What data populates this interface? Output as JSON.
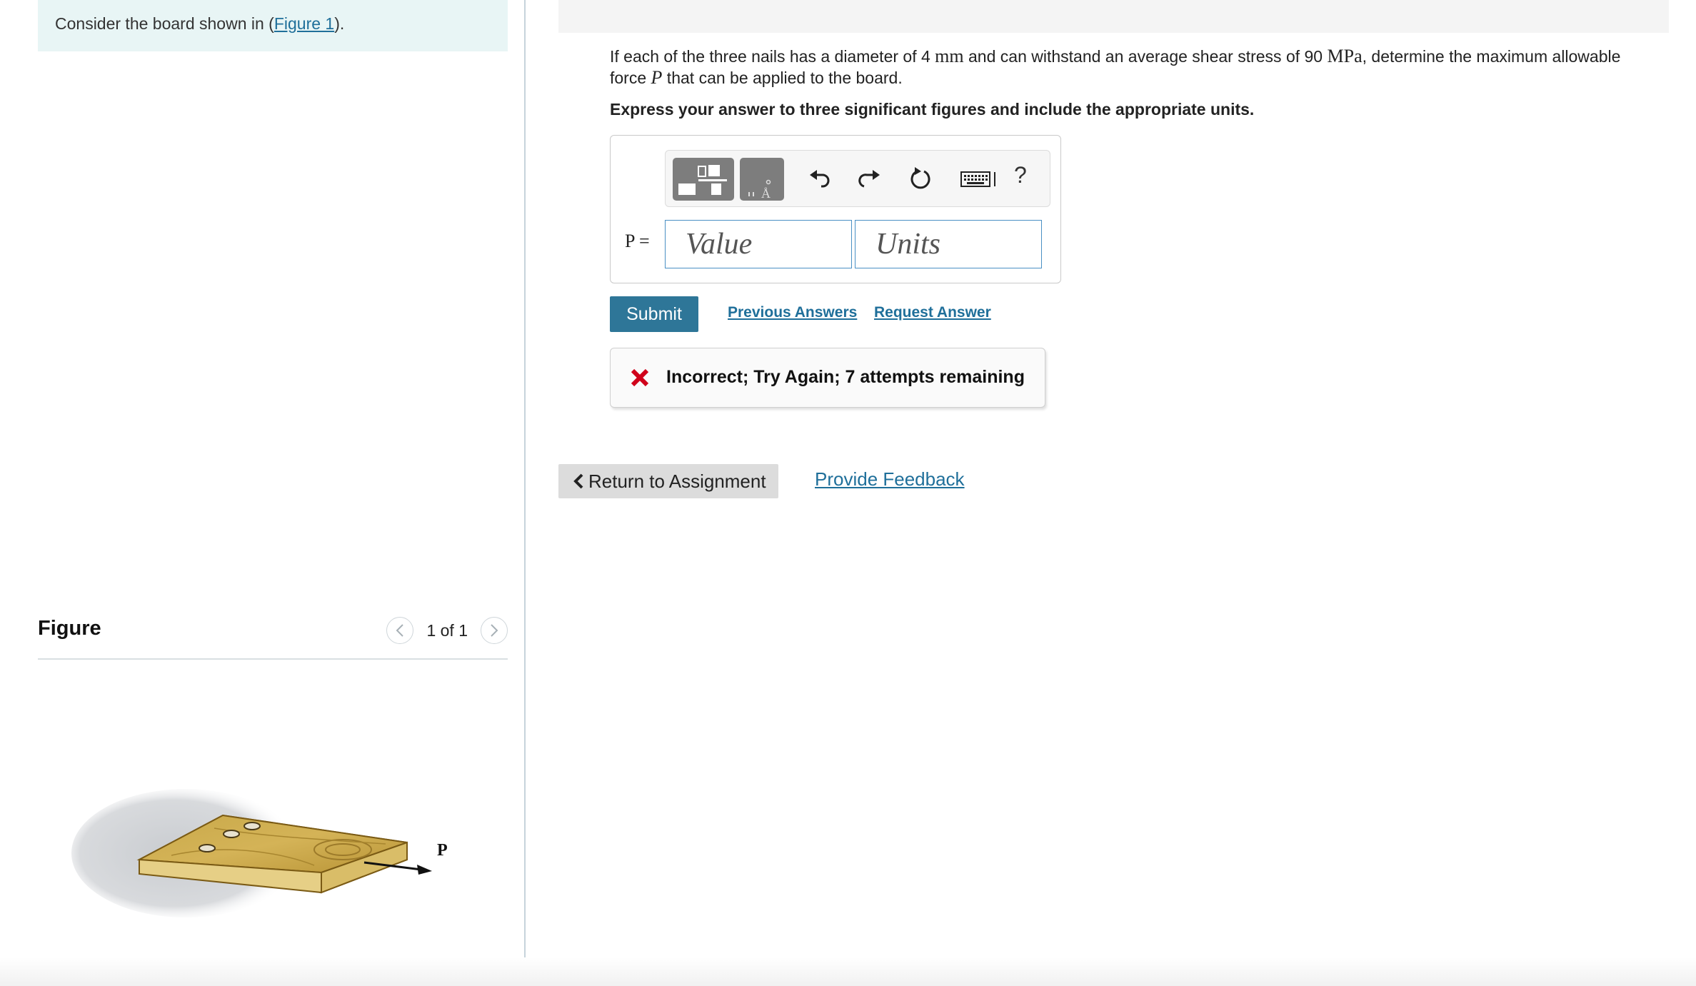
{
  "context": {
    "prefix": "Consider the board shown in (",
    "link": "Figure 1",
    "suffix": ")."
  },
  "figure": {
    "title": "Figure",
    "page": "1 of 1",
    "prev_icon": "chevron-left-icon",
    "next_icon": "chevron-right-icon",
    "force_label": "P"
  },
  "question": {
    "t1": "If each of the three nails has a diameter of 4 ",
    "u1": "mm",
    "t2": " and can withstand an average shear stress of 90 ",
    "u2": "MPa",
    "t3": ", determine the maximum allowable force ",
    "var": "P",
    "t4": " that can be applied to the board."
  },
  "instruction": "Express your answer to three significant figures and include the appropriate units.",
  "answer": {
    "variable_label": "P =",
    "value_placeholder": "Value",
    "units_placeholder": "Units",
    "value": "",
    "units": ""
  },
  "toolbar": {
    "icons": [
      "templates-icon",
      "units-icon",
      "undo-icon",
      "redo-icon",
      "reset-icon",
      "keyboard-icon",
      "help-icon"
    ],
    "help_label": "?"
  },
  "actions": {
    "submit": "Submit",
    "previous_answers": "Previous Answers",
    "request_answer": "Request Answer"
  },
  "feedback": {
    "message": "Incorrect; Try Again; 7 attempts remaining",
    "status_color": "#d0021b"
  },
  "navigation": {
    "return": "Return to Assignment",
    "provide_feedback": "Provide Feedback"
  },
  "colors": {
    "accent": "#2e7698",
    "link": "#1f6f9a",
    "context_bg": "#e8f5f5"
  }
}
